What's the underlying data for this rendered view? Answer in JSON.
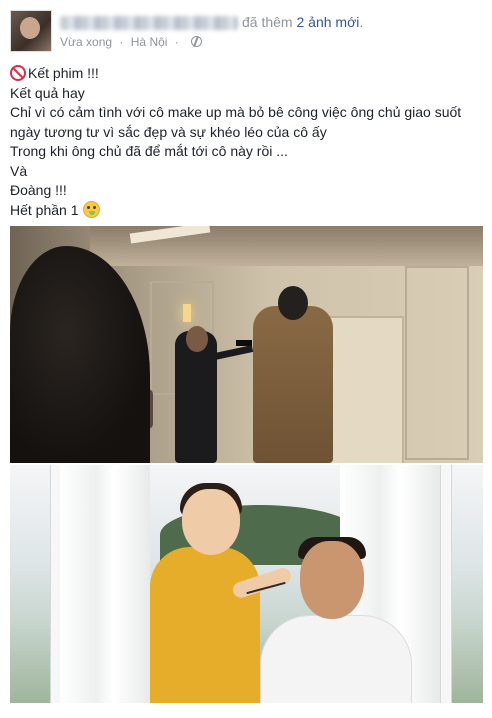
{
  "post": {
    "action_text": "đã thêm",
    "photos_link": "2 ảnh mới",
    "photos_link_end": ".",
    "timestamp": "Vừa xong",
    "separator": "·",
    "location": "Hà Nội",
    "privacy_icon": "globe-icon"
  },
  "body": {
    "line1": "Kết phim !!!",
    "line2": "Kết quả hay",
    "line3": "Chỉ vì có cảm tình với cô make up mà bỏ bê công việc ông chủ giao suốt",
    "line4": "ngày tương tư vì sắc đẹp và sự khéo léo của cô ấy",
    "line5": "Trong khi ông chủ đã để mắt tới cô này rồi ...",
    "line6": "Và",
    "line7": "Đoàng !!!",
    "line8": "Hết phần 1",
    "line1_icon": "no-entry-icon",
    "line8_icon": "money-mouth-emoji-icon"
  },
  "photos": [
    {
      "name": "film-scene-photo"
    },
    {
      "name": "makeup-behind-scenes-photo"
    }
  ],
  "colors": {
    "link": "#365899",
    "meta": "#90949c",
    "text": "#1d2129"
  }
}
